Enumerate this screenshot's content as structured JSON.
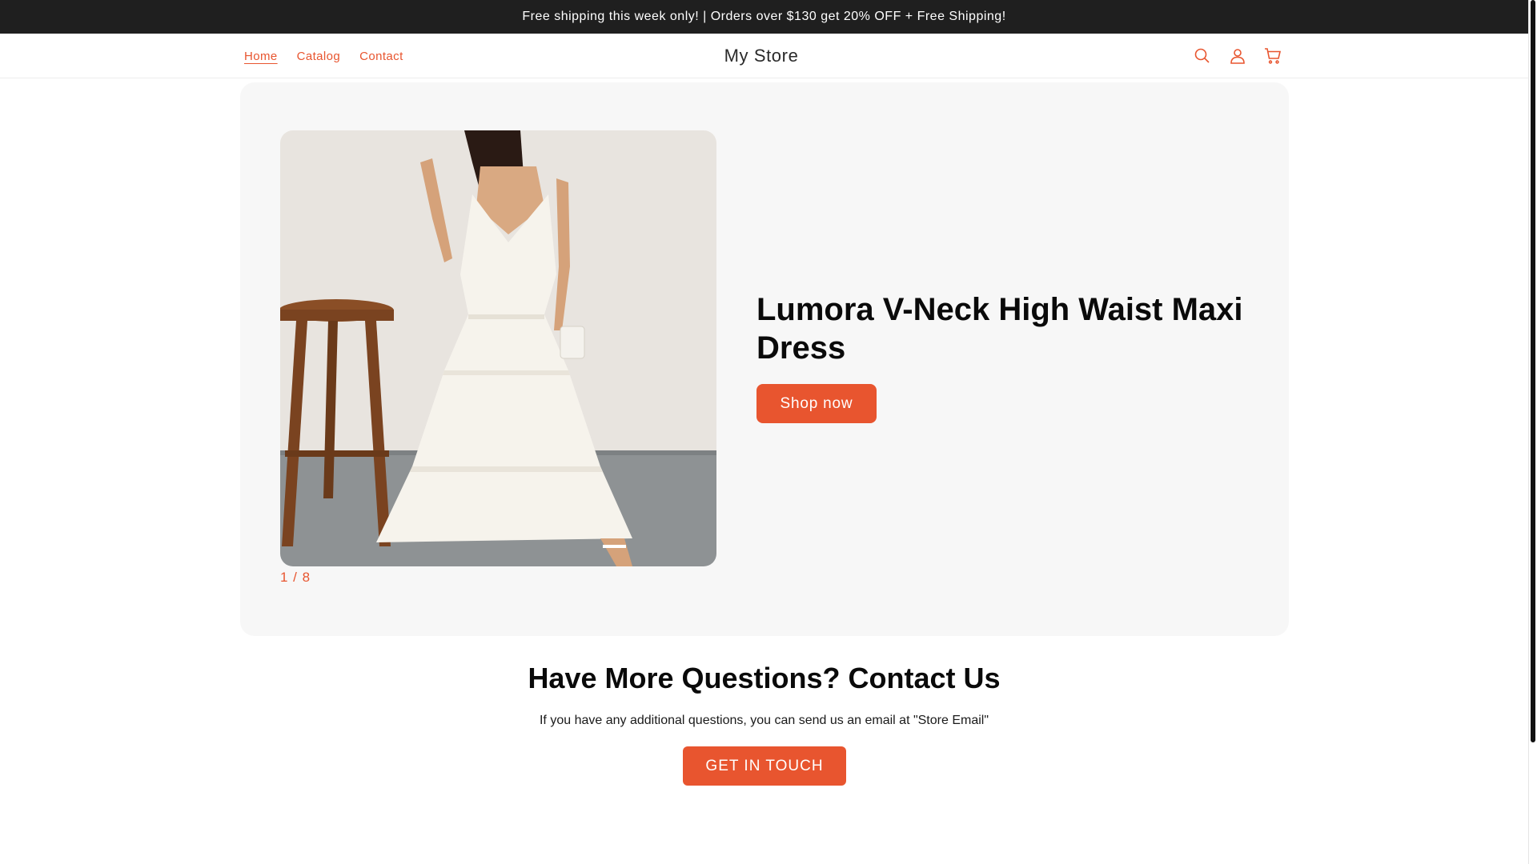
{
  "announcement": {
    "text": "Free shipping this week only! | Orders over $130 get 20% OFF + Free Shipping!"
  },
  "header": {
    "nav": [
      {
        "label": "Home",
        "active": true
      },
      {
        "label": "Catalog",
        "active": false
      },
      {
        "label": "Contact",
        "active": false
      }
    ],
    "logo": "My Store",
    "icons": [
      "search-icon",
      "account-icon",
      "cart-icon"
    ]
  },
  "hero": {
    "title": "Lumora V-Neck High Waist Maxi Dress",
    "button_label": "Shop now",
    "slide_counter": "1 / 8",
    "image_alt": "white-halter-maxi-dress-photo"
  },
  "contact": {
    "title": "Have More Questions? Contact Us",
    "text": "If you have any additional questions, you can send us an email at \"Store Email\"",
    "button_label": "GET IN TOUCH"
  },
  "colors": {
    "accent": "#e8552f",
    "announcement_bg": "#1f1f1f",
    "hero_bg": "#f7f7f7"
  }
}
